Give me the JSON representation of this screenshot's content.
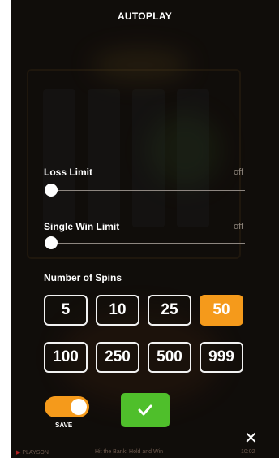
{
  "dialog": {
    "title": "AUTOPLAY"
  },
  "loss_limit": {
    "label": "Loss Limit",
    "value_text": "off",
    "level": 0
  },
  "single_win_limit": {
    "label": "Single Win Limit",
    "value_text": "off",
    "level": 0
  },
  "spins": {
    "label": "Number of Spins",
    "options": [
      "5",
      "10",
      "25",
      "50",
      "100",
      "250",
      "500",
      "999"
    ],
    "selected": "50"
  },
  "save_toggle": {
    "label": "SAVE",
    "on": true
  },
  "confirm_button": {
    "icon": "check-icon"
  },
  "close_button": {
    "icon": "close-icon",
    "glyph": "✕"
  },
  "footer": {
    "brand": "PLAYSON",
    "game_name": "Hit the Bank: Hold and Win",
    "clock": "10:02"
  },
  "colors": {
    "accent": "#f59a1b",
    "confirm": "#4fbf2b",
    "panel_bg": "#1a1410"
  }
}
